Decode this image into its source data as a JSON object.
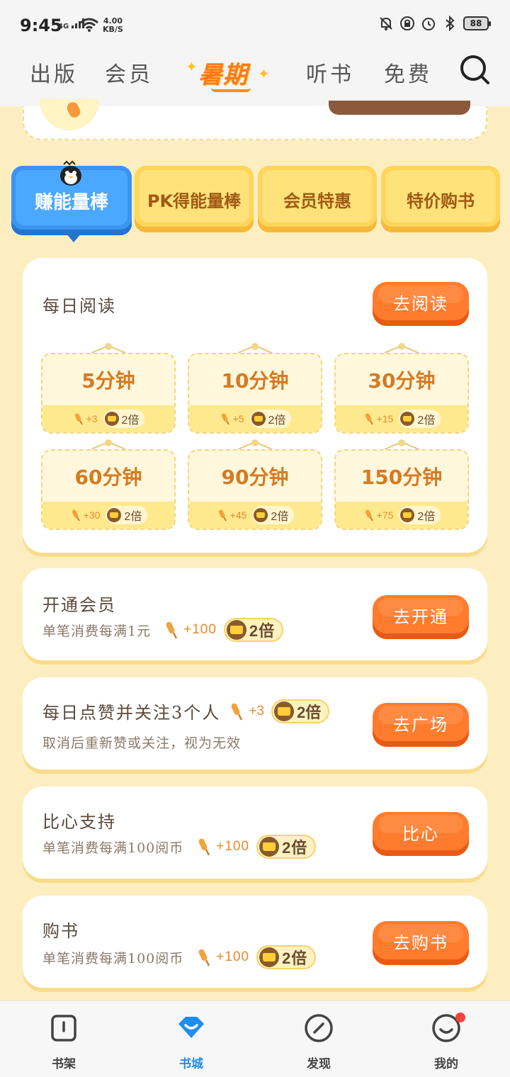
{
  "status_bar": {
    "time": "9:45",
    "network": "4G",
    "speed_value": "4.00",
    "speed_unit": "KB/S",
    "battery": "88"
  },
  "top_nav": {
    "tabs": [
      "出版",
      "会员",
      "暑期",
      "听书",
      "免费"
    ],
    "active": "暑期"
  },
  "category_tabs": {
    "items": [
      "赚能量棒",
      "PK得能量棒",
      "会员特惠",
      "特价购书"
    ],
    "active": "赚能量棒"
  },
  "daily_reading": {
    "title": "每日阅读",
    "button": "去阅读",
    "items": [
      {
        "time": "5分钟",
        "bonus": "+3",
        "multiplier": "2倍"
      },
      {
        "time": "10分钟",
        "bonus": "+5",
        "multiplier": "2倍"
      },
      {
        "time": "30分钟",
        "bonus": "+15",
        "multiplier": "2倍"
      },
      {
        "time": "60分钟",
        "bonus": "+30",
        "multiplier": "2倍"
      },
      {
        "time": "90分钟",
        "bonus": "+45",
        "multiplier": "2倍"
      },
      {
        "time": "150分钟",
        "bonus": "+75",
        "multiplier": "2倍"
      }
    ]
  },
  "tasks": [
    {
      "title": "开通会员",
      "subtitle": "单笔消费每满1元",
      "bonus": "+100",
      "multiplier": "2倍",
      "button": "去开通"
    },
    {
      "title": "每日点赞并关注3个人",
      "title_bonus": "+3",
      "title_multiplier": "2倍",
      "subtitle": "取消后重新赞或关注，视为无效",
      "button": "去广场"
    },
    {
      "title": "比心支持",
      "subtitle": "单笔消费每满100阅币",
      "bonus": "+100",
      "multiplier": "2倍",
      "button": "比心"
    },
    {
      "title": "购书",
      "subtitle": "单笔消费每满100阅币",
      "bonus": "+100",
      "multiplier": "2倍",
      "button": "去购书"
    }
  ],
  "bottom_nav": {
    "items": [
      "书架",
      "书城",
      "发现",
      "我的"
    ],
    "active": "书城"
  },
  "colors": {
    "accent": "#ff7b2e",
    "active_tab": "#3b94f0",
    "background": "#fdeec2"
  }
}
